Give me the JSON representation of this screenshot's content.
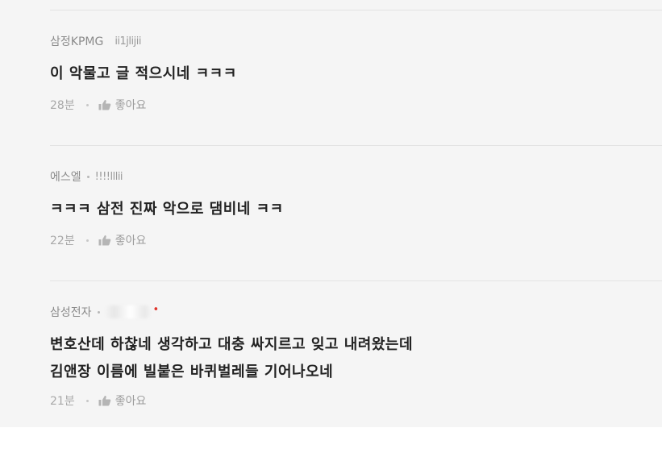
{
  "comments": [
    {
      "company": "삼정KPMG",
      "nickname": "ii1jlijii",
      "text_lines": [
        "이 악물고 글 적으시네 ㅋㅋㅋ"
      ],
      "time": "28분",
      "like_label": "좋아요"
    },
    {
      "company": "에스엘",
      "nickname": "!!!!lllii",
      "text_lines": [
        "ㅋㅋㅋ 삼전 진짜 악으로 댐비네 ㅋㅋ"
      ],
      "time": "22분",
      "like_label": "좋아요"
    },
    {
      "company": "삼성전자",
      "nickname": "",
      "author_badge": "•",
      "text_lines": [
        "변호산데 하찮네 생각하고 대충 싸지르고 잊고 내려왔는데",
        "김앤장 이름에 빌붙은 바퀴벌레들 기어나오네"
      ],
      "time": "21분",
      "like_label": "좋아요"
    }
  ],
  "colors": {
    "background": "#f5f5f5",
    "text": "#222222",
    "meta": "#8b8b8b",
    "badge": "#e0342b"
  },
  "icons": {
    "like": "thumbs-up-icon"
  }
}
